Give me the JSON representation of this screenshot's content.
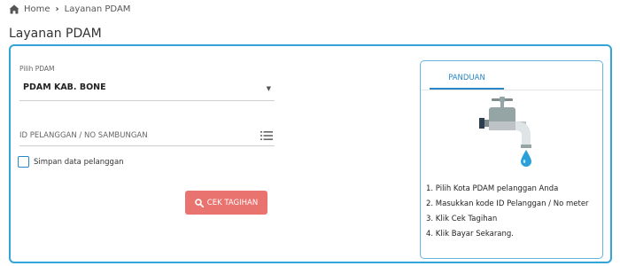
{
  "breadcrumb": {
    "home_icon": "home-icon",
    "home": "Home",
    "separator_icon": "chevron-right-icon",
    "current": "Layanan PDAM"
  },
  "page_title": "Layanan PDAM",
  "form": {
    "select_label": "Pilih PDAM",
    "select_value": "PDAM KAB. BONE",
    "caret_icon": "caret-down-icon",
    "id_placeholder": "ID PELANGGAN / NO SAMBUNGAN",
    "id_value": "",
    "list_icon": "list-icon",
    "checkbox_label": "Simpan data pelanggan",
    "checkbox_checked": false,
    "button_label": "CEK TAGIHAN",
    "button_icon": "search-icon"
  },
  "panduan": {
    "tab_label": "PANDUAN",
    "illustration": "water-faucet-icon",
    "steps": [
      "1. Pilih Kota PDAM pelanggan Anda",
      "2. Masukkan kode ID Pelanggan / No meter",
      "3. Klik Cek Tagihan",
      "4. Klik Bayar Sekarang."
    ]
  },
  "colors": {
    "accent_blue": "#34a3d8",
    "tab_blue": "#2a86c8",
    "button_red": "#e8736f"
  }
}
